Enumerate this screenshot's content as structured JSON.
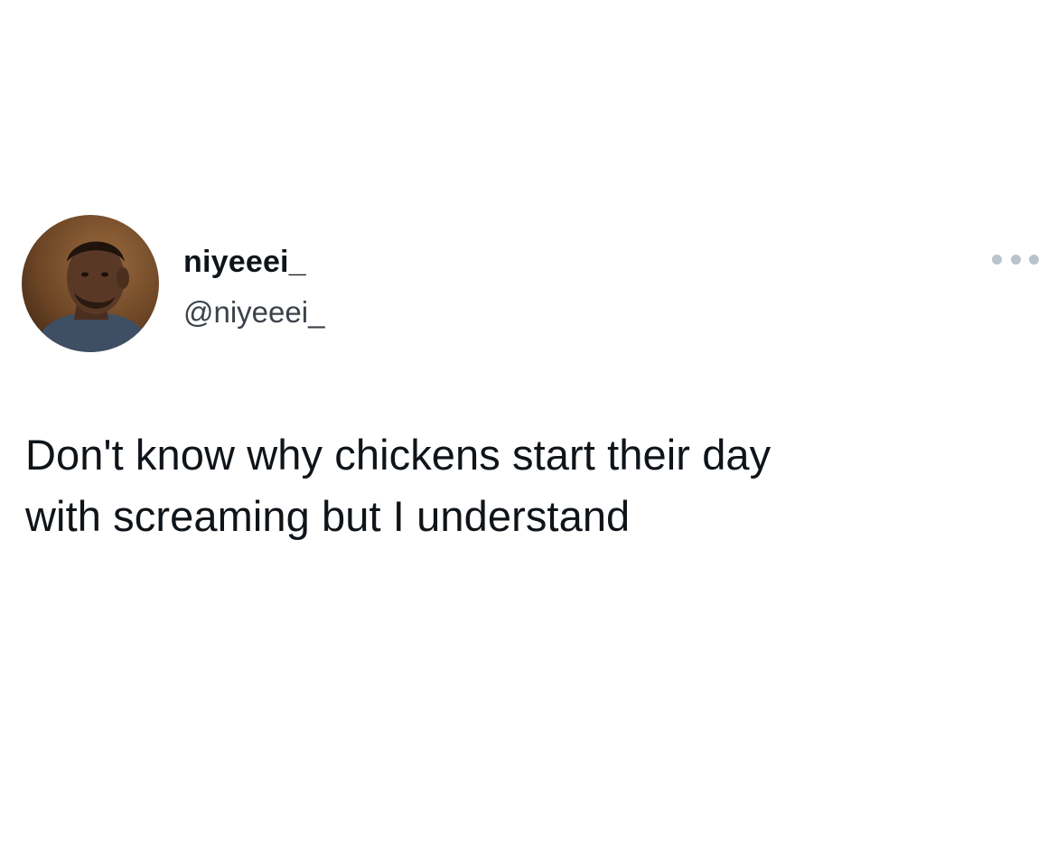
{
  "tweet": {
    "author": {
      "display_name": "niyeeei_",
      "handle": "@niyeeei_",
      "avatar_icon": "profile-photo"
    },
    "more_icon": "more-horizontal-icon",
    "text": "Don't know why chickens start their day\nwith screaming but I understand"
  },
  "colors": {
    "background": "#ffffff",
    "text": "#0f1419",
    "handle": "#3c4249",
    "more_dots": "#b9c3cc"
  }
}
